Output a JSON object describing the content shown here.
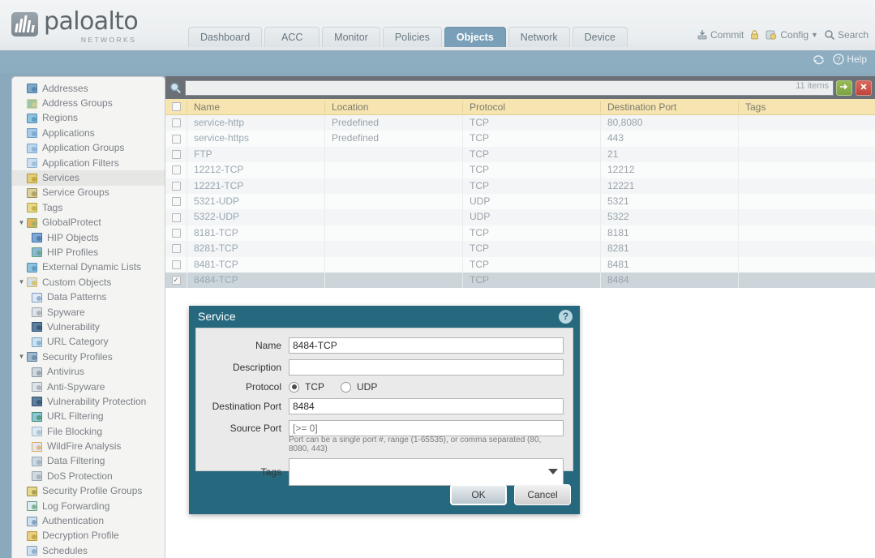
{
  "brand": {
    "name": "paloalto",
    "tagline": "NETWORKS"
  },
  "tabs": [
    {
      "label": "Dashboard",
      "active": false
    },
    {
      "label": "ACC",
      "active": false
    },
    {
      "label": "Monitor",
      "active": false
    },
    {
      "label": "Policies",
      "active": false
    },
    {
      "label": "Objects",
      "active": true
    },
    {
      "label": "Network",
      "active": false
    },
    {
      "label": "Device",
      "active": false
    }
  ],
  "header_tools": [
    {
      "label": "Commit",
      "icon": "commit-icon"
    },
    {
      "label": "",
      "icon": "lock-icon"
    },
    {
      "label": "Config",
      "icon": "config-icon",
      "caret": true
    },
    {
      "label": "Search",
      "icon": "search-icon"
    }
  ],
  "band_tools": [
    {
      "label": "",
      "icon": "refresh-icon"
    },
    {
      "label": "Help",
      "icon": "help-icon"
    }
  ],
  "sidebar": {
    "items": [
      {
        "label": "Addresses",
        "level": 1,
        "twisty": "",
        "icon": "addresses-icon",
        "selected": false
      },
      {
        "label": "Address Groups",
        "level": 1,
        "twisty": "",
        "icon": "address-groups-icon",
        "selected": false
      },
      {
        "label": "Regions",
        "level": 1,
        "twisty": "",
        "icon": "regions-icon",
        "selected": false
      },
      {
        "label": "Applications",
        "level": 1,
        "twisty": "",
        "icon": "applications-icon",
        "selected": false
      },
      {
        "label": "Application Groups",
        "level": 1,
        "twisty": "",
        "icon": "application-groups-icon",
        "selected": false
      },
      {
        "label": "Application Filters",
        "level": 1,
        "twisty": "",
        "icon": "application-filters-icon",
        "selected": false
      },
      {
        "label": "Services",
        "level": 1,
        "twisty": "",
        "icon": "services-icon",
        "selected": true
      },
      {
        "label": "Service Groups",
        "level": 1,
        "twisty": "",
        "icon": "service-groups-icon",
        "selected": false
      },
      {
        "label": "Tags",
        "level": 1,
        "twisty": "",
        "icon": "tags-icon",
        "selected": false
      },
      {
        "label": "GlobalProtect",
        "level": 1,
        "twisty": "▼",
        "icon": "globalprotect-icon",
        "selected": false
      },
      {
        "label": "HIP Objects",
        "level": 2,
        "twisty": "",
        "icon": "hip-objects-icon",
        "selected": false
      },
      {
        "label": "HIP Profiles",
        "level": 2,
        "twisty": "",
        "icon": "hip-profiles-icon",
        "selected": false
      },
      {
        "label": "External Dynamic Lists",
        "level": 1,
        "twisty": "",
        "icon": "external-dynamic-lists-icon",
        "selected": false
      },
      {
        "label": "Custom Objects",
        "level": 1,
        "twisty": "▼",
        "icon": "custom-objects-icon",
        "selected": false
      },
      {
        "label": "Data Patterns",
        "level": 2,
        "twisty": "",
        "icon": "data-patterns-icon",
        "selected": false
      },
      {
        "label": "Spyware",
        "level": 2,
        "twisty": "",
        "icon": "spyware-icon",
        "selected": false
      },
      {
        "label": "Vulnerability",
        "level": 2,
        "twisty": "",
        "icon": "vulnerability-icon",
        "selected": false
      },
      {
        "label": "URL Category",
        "level": 2,
        "twisty": "",
        "icon": "url-category-icon",
        "selected": false
      },
      {
        "label": "Security Profiles",
        "level": 1,
        "twisty": "▼",
        "icon": "security-profiles-icon",
        "selected": false
      },
      {
        "label": "Antivirus",
        "level": 2,
        "twisty": "",
        "icon": "antivirus-icon",
        "selected": false
      },
      {
        "label": "Anti-Spyware",
        "level": 2,
        "twisty": "",
        "icon": "anti-spyware-icon",
        "selected": false
      },
      {
        "label": "Vulnerability Protection",
        "level": 2,
        "twisty": "",
        "icon": "vulnerability-protection-icon",
        "selected": false
      },
      {
        "label": "URL Filtering",
        "level": 2,
        "twisty": "",
        "icon": "url-filtering-icon",
        "selected": false
      },
      {
        "label": "File Blocking",
        "level": 2,
        "twisty": "",
        "icon": "file-blocking-icon",
        "selected": false
      },
      {
        "label": "WildFire Analysis",
        "level": 2,
        "twisty": "",
        "icon": "wildfire-analysis-icon",
        "selected": false
      },
      {
        "label": "Data Filtering",
        "level": 2,
        "twisty": "",
        "icon": "data-filtering-icon",
        "selected": false
      },
      {
        "label": "DoS Protection",
        "level": 2,
        "twisty": "",
        "icon": "dos-protection-icon",
        "selected": false
      },
      {
        "label": "Security Profile Groups",
        "level": 1,
        "twisty": "",
        "icon": "security-profile-groups-icon",
        "selected": false
      },
      {
        "label": "Log Forwarding",
        "level": 1,
        "twisty": "",
        "icon": "log-forwarding-icon",
        "selected": false
      },
      {
        "label": "Authentication",
        "level": 1,
        "twisty": "",
        "icon": "authentication-icon",
        "selected": false
      },
      {
        "label": "Decryption Profile",
        "level": 1,
        "twisty": "",
        "icon": "decryption-profile-icon",
        "selected": false
      },
      {
        "label": "Schedules",
        "level": 1,
        "twisty": "",
        "icon": "schedules-icon",
        "selected": false
      }
    ]
  },
  "search": {
    "value": "",
    "placeholder": "",
    "item_count": "11 items",
    "apply_icon": "arrow-right-icon",
    "clear_icon": "close-icon"
  },
  "table": {
    "columns": [
      "Name",
      "Location",
      "Protocol",
      "Destination Port",
      "Tags"
    ],
    "rows": [
      {
        "name": "service-http",
        "location": "Predefined",
        "protocol": "TCP",
        "port": "80,8080",
        "tags": "",
        "checked": false
      },
      {
        "name": "service-https",
        "location": "Predefined",
        "protocol": "TCP",
        "port": "443",
        "tags": "",
        "checked": false
      },
      {
        "name": "FTP",
        "location": "",
        "protocol": "TCP",
        "port": "21",
        "tags": "",
        "checked": false
      },
      {
        "name": "12212-TCP",
        "location": "",
        "protocol": "TCP",
        "port": "12212",
        "tags": "",
        "checked": false
      },
      {
        "name": "12221-TCP",
        "location": "",
        "protocol": "TCP",
        "port": "12221",
        "tags": "",
        "checked": false
      },
      {
        "name": "5321-UDP",
        "location": "",
        "protocol": "UDP",
        "port": "5321",
        "tags": "",
        "checked": false
      },
      {
        "name": "5322-UDP",
        "location": "",
        "protocol": "UDP",
        "port": "5322",
        "tags": "",
        "checked": false
      },
      {
        "name": "8181-TCP",
        "location": "",
        "protocol": "TCP",
        "port": "8181",
        "tags": "",
        "checked": false
      },
      {
        "name": "8281-TCP",
        "location": "",
        "protocol": "TCP",
        "port": "8281",
        "tags": "",
        "checked": false
      },
      {
        "name": "8481-TCP",
        "location": "",
        "protocol": "TCP",
        "port": "8481",
        "tags": "",
        "checked": false
      },
      {
        "name": "8484-TCP",
        "location": "",
        "protocol": "TCP",
        "port": "8484",
        "tags": "",
        "checked": true
      }
    ]
  },
  "dialog": {
    "title": "Service",
    "help_icon": "question-icon",
    "fields": {
      "name_label": "Name",
      "name_value": "8484-TCP",
      "description_label": "Description",
      "description_value": "",
      "protocol_label": "Protocol",
      "protocol_tcp": "TCP",
      "protocol_udp": "UDP",
      "protocol_selected": "TCP",
      "destination_port_label": "Destination Port",
      "destination_port_value": "8484",
      "source_port_label": "Source Port",
      "source_port_placeholder": "[>= 0]",
      "help_text": "Port can be a single port #, range (1-65535), or comma separated (80, 8080, 443)",
      "tags_label": "Tags",
      "tags_value": ""
    },
    "ok_label": "OK",
    "cancel_label": "Cancel"
  },
  "colors": {
    "tab_active_bg": "#79a0b8",
    "band_bg": "#8badbf",
    "dialog_bg": "#26697f",
    "header_row_bg": "#f6e5b0",
    "selected_row_bg": "#ccd6da",
    "apply_green": "#7da343",
    "clear_red": "#c0453a"
  }
}
